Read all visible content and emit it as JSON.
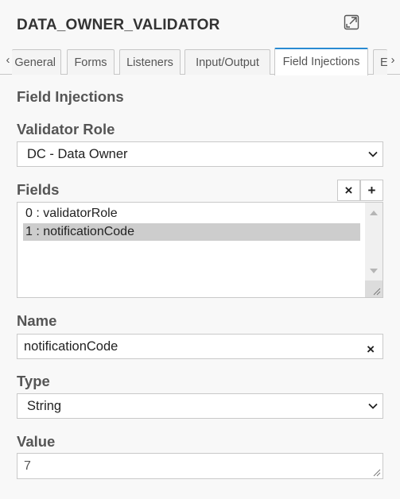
{
  "header": {
    "title": "DATA_OWNER_VALIDATOR",
    "expand_icon": "expand-icon"
  },
  "tabs": {
    "prev_arrow": "‹",
    "next_arrow": "›",
    "items": [
      {
        "label": "General"
      },
      {
        "label": "Forms"
      },
      {
        "label": "Listeners"
      },
      {
        "label": "Input/Output"
      },
      {
        "label": "Field Injections",
        "active": true
      },
      {
        "label": "E"
      }
    ]
  },
  "section": {
    "title": "Field Injections"
  },
  "validator_role": {
    "label": "Validator Role",
    "value": "DC - Data Owner"
  },
  "fields": {
    "label": "Fields",
    "remove_label": "×",
    "add_label": "+",
    "items": [
      {
        "text": "0 : validatorRole",
        "selected": false
      },
      {
        "text": "1 : notificationCode",
        "selected": true
      }
    ]
  },
  "name": {
    "label": "Name",
    "value": "notificationCode",
    "clear_label": "×"
  },
  "type": {
    "label": "Type",
    "value": "String"
  },
  "value": {
    "label": "Value",
    "value": "7"
  },
  "colors": {
    "accent": "#2a8bd2",
    "selected_row": "#cdcdcd",
    "panel_bg": "#f8f8f8"
  }
}
